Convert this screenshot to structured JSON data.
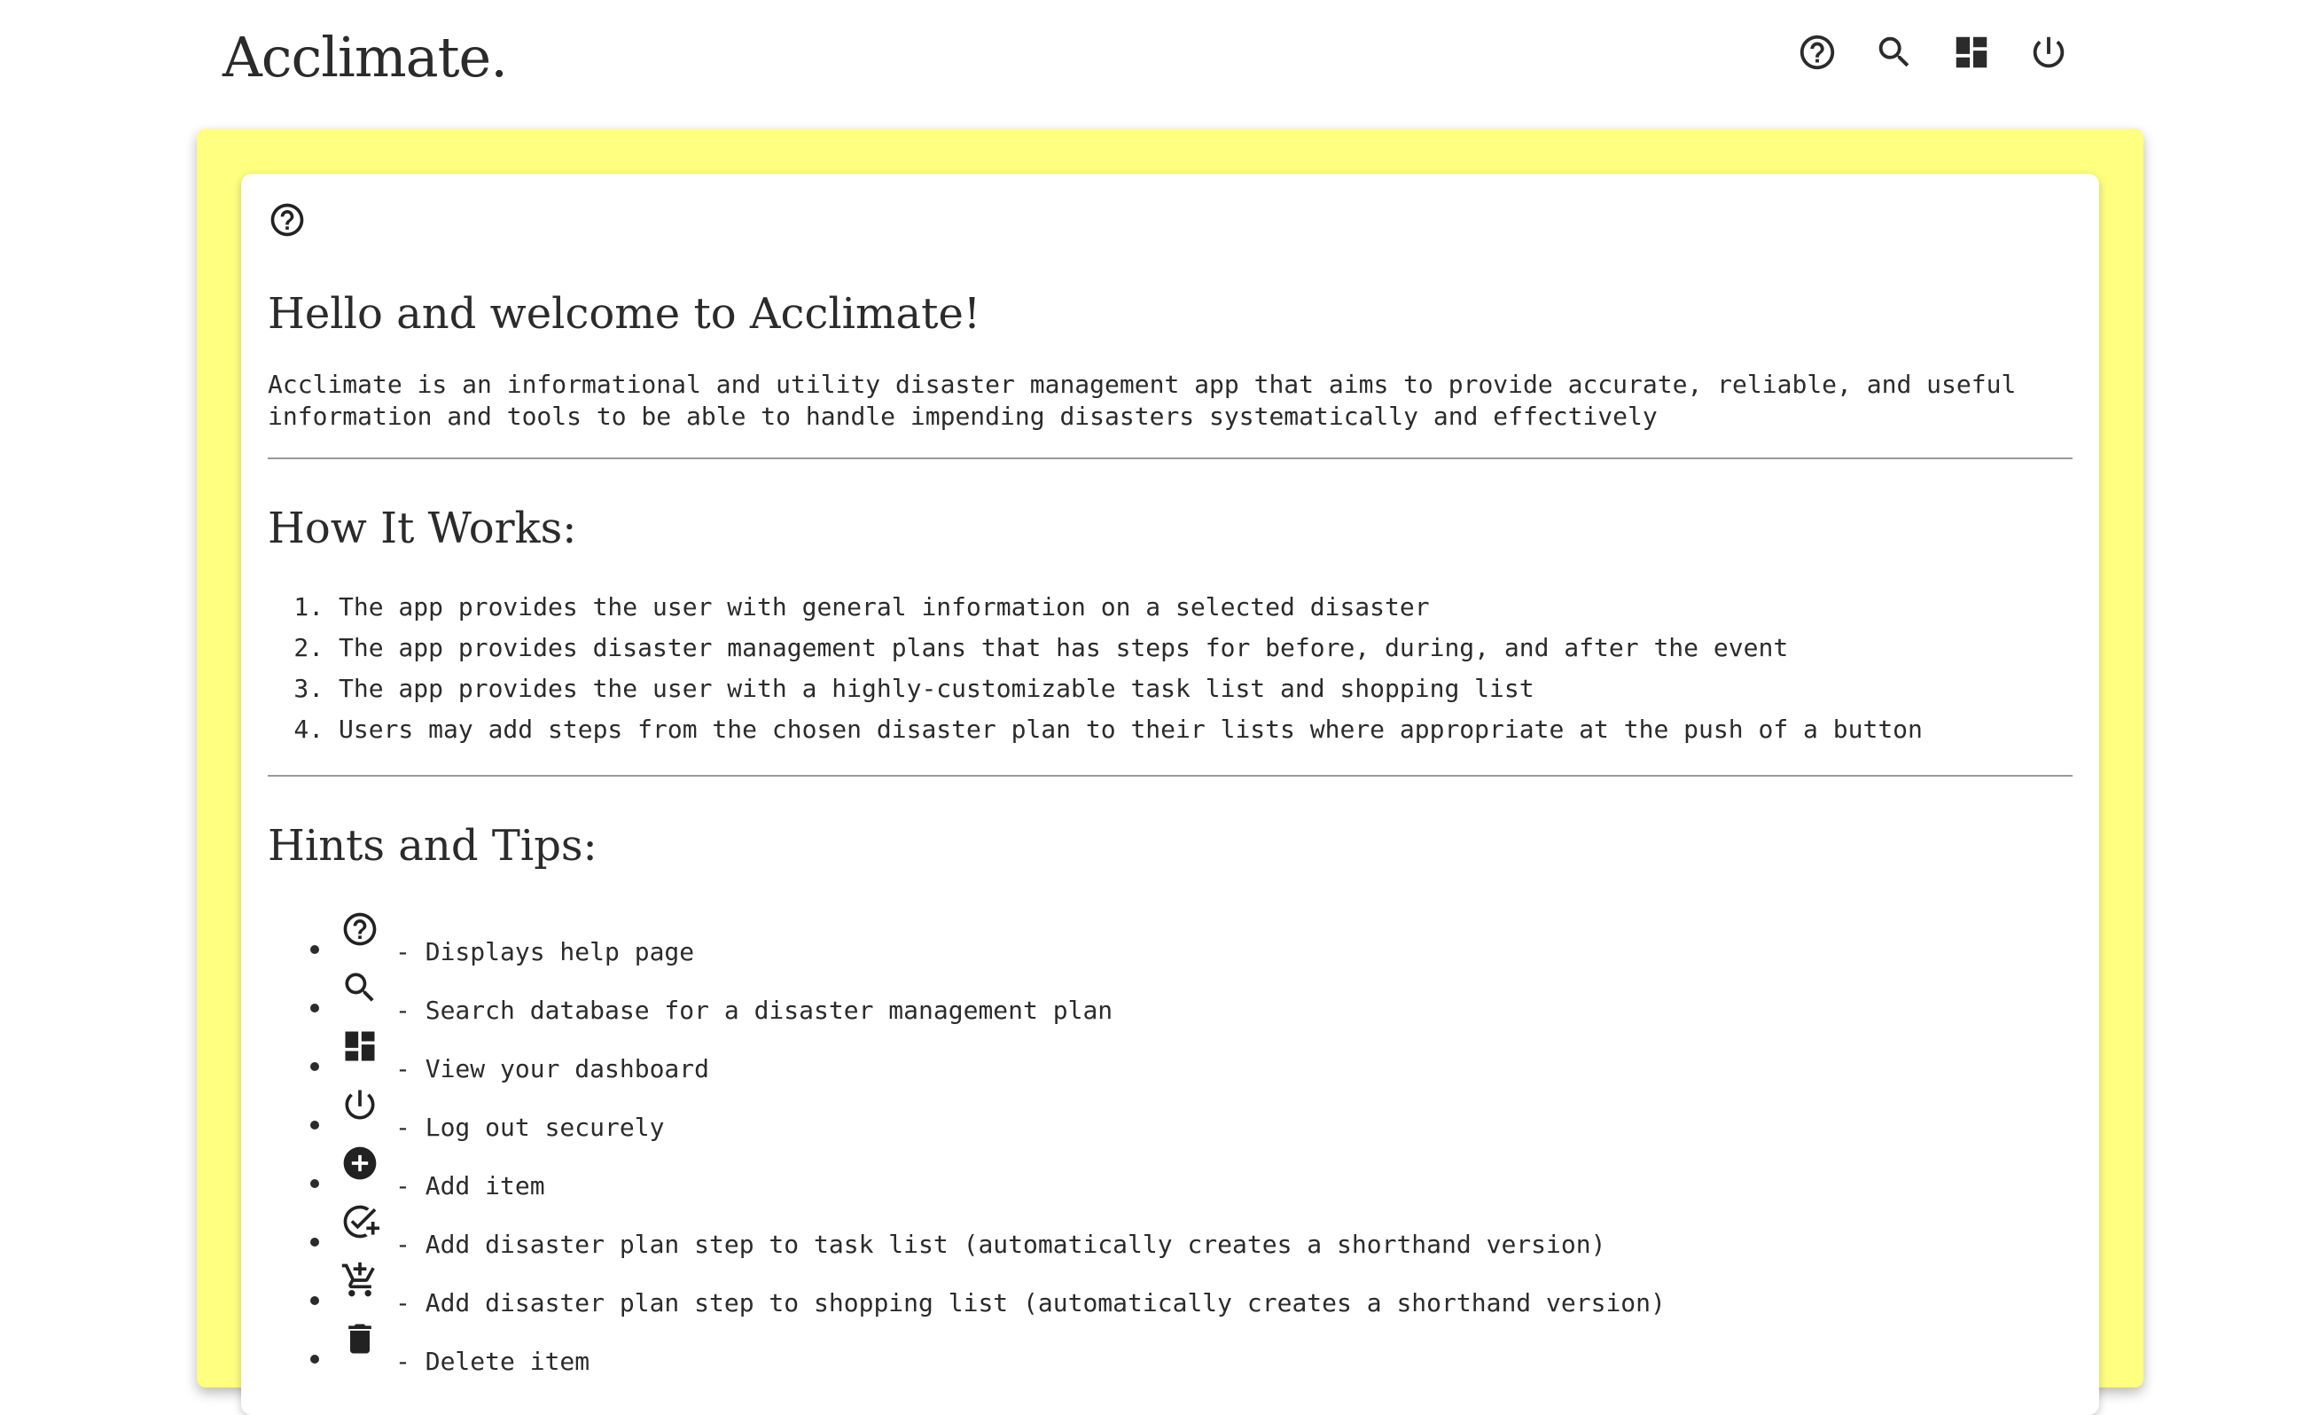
{
  "header": {
    "brand": "Acclimate.",
    "nav": [
      {
        "name": "help-icon"
      },
      {
        "name": "search-icon"
      },
      {
        "name": "dashboard-icon"
      },
      {
        "name": "power-icon"
      }
    ]
  },
  "colors": {
    "frame": "#ffff80",
    "card": "#ffffff",
    "text": "#2b2b2b",
    "divider": "#9a9a9a"
  },
  "page": {
    "card_icon": "help-icon",
    "welcome_title": "Hello and welcome to Acclimate!",
    "intro": "Acclimate is an informational and utility disaster management app that aims to provide accurate, reliable, and useful information and tools to be able to handle impending disasters systematically and effectively",
    "how_title": "How It Works:",
    "steps": [
      "The app provides the user with general information on a selected disaster",
      "The app provides disaster management plans that has steps for before, during, and after the event",
      "The app provides the user with a highly-customizable task list and shopping list",
      "Users may add steps from the chosen disaster plan to their lists where appropriate at the push of a button"
    ],
    "tips_title": "Hints and Tips:",
    "tips": [
      {
        "icon": "help-icon",
        "text": "- Displays help page"
      },
      {
        "icon": "search-icon",
        "text": "- Search database for a disaster management plan"
      },
      {
        "icon": "dashboard-icon",
        "text": "- View your dashboard"
      },
      {
        "icon": "power-icon",
        "text": "- Log out securely"
      },
      {
        "icon": "add-circle-icon",
        "text": "- Add item"
      },
      {
        "icon": "add-task-icon",
        "text": "- Add disaster plan step to task list (automatically creates a shorthand version)"
      },
      {
        "icon": "add-shopping-cart-icon",
        "text": "- Add disaster plan step to shopping list (automatically creates a shorthand version)"
      },
      {
        "icon": "delete-icon",
        "text": "- Delete item"
      }
    ]
  }
}
